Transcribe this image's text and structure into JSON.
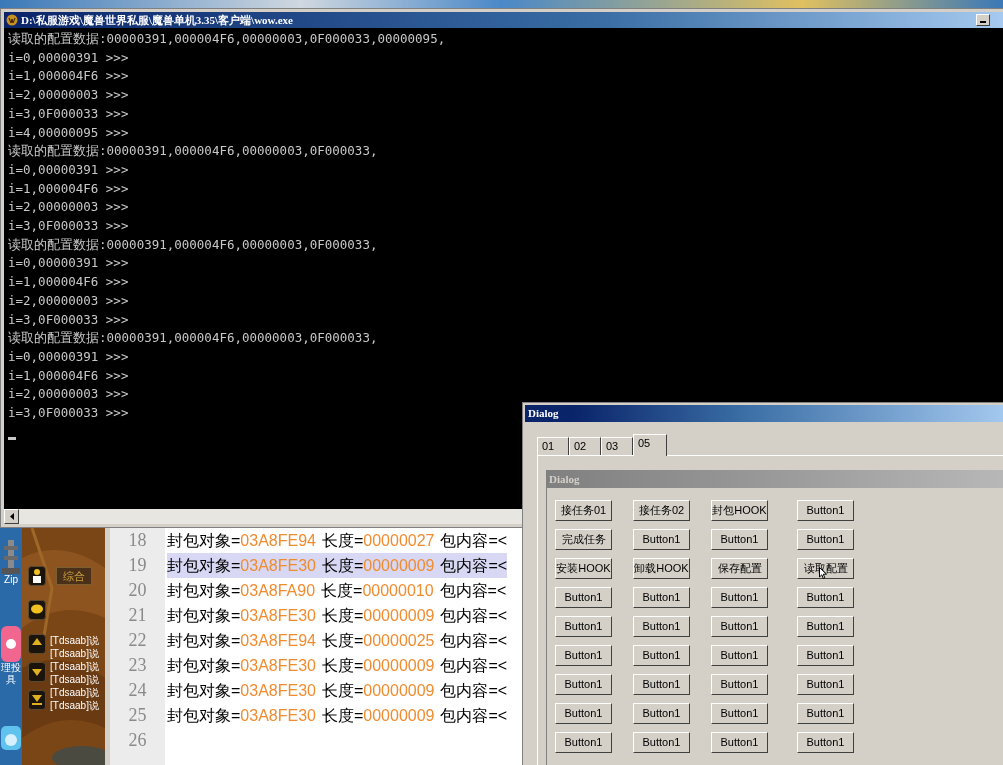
{
  "desktop_icons": [
    {
      "kind": "zip",
      "labels": [
        "Zip"
      ]
    },
    {
      "kind": "app",
      "labels": [
        "理投",
        "具"
      ]
    },
    {
      "kind": "face"
    }
  ],
  "game_chat": {
    "tab": "综合",
    "messages": [
      "[Tdsaab]说",
      "[Tdsaab]说",
      "[Tdsaab]说",
      "[Tdsaab]说",
      "[Tdsaab]说",
      "[Tdsaab]说"
    ]
  },
  "editor": {
    "lines": [
      {
        "number": "18",
        "object_label": "封包对象=",
        "object": "03A8FE94",
        "length_label": "长度=",
        "length": "00000027",
        "content_label": "包内容=<",
        "selected": false
      },
      {
        "number": "19",
        "object_label": "封包对象=",
        "object": "03A8FE30",
        "length_label": "长度=",
        "length": "00000009",
        "content_label": "包内容=<",
        "selected": true
      },
      {
        "number": "20",
        "object_label": "封包对象=",
        "object": "03A8FA90",
        "length_label": "长度=",
        "length": "00000010",
        "content_label": "包内容=<",
        "selected": false
      },
      {
        "number": "21",
        "object_label": "封包对象=",
        "object": "03A8FE30",
        "length_label": "长度=",
        "length": "00000009",
        "content_label": "包内容=<",
        "selected": false
      },
      {
        "number": "22",
        "object_label": "封包对象=",
        "object": "03A8FE94",
        "length_label": "长度=",
        "length": "00000025",
        "content_label": "包内容=<",
        "selected": false
      },
      {
        "number": "23",
        "object_label": "封包对象=",
        "object": "03A8FE30",
        "length_label": "长度=",
        "length": "00000009",
        "content_label": "包内容=<",
        "selected": false
      },
      {
        "number": "24",
        "object_label": "封包对象=",
        "object": "03A8FE30",
        "length_label": "长度=",
        "length": "00000009",
        "content_label": "包内容=<",
        "selected": false
      },
      {
        "number": "25",
        "object_label": "封包对象=",
        "object": "03A8FE30",
        "length_label": "长度=",
        "length": "00000009",
        "content_label": "包内容=<",
        "selected": false
      },
      {
        "number": "26"
      }
    ]
  },
  "console_window": {
    "title": "D:\\私服游戏\\魔兽世界私服\\魔兽单机3.35\\客户端\\wow.exe",
    "lines": [
      "读取的配置数据:00000391,000004F6,00000003,0F000033,00000095,",
      "i=0,00000391 >>>",
      "i=1,000004F6 >>>",
      "i=2,00000003 >>>",
      "i=3,0F000033 >>>",
      "i=4,00000095 >>>",
      "读取的配置数据:00000391,000004F6,00000003,0F000033,",
      "i=0,00000391 >>>",
      "i=1,000004F6 >>>",
      "i=2,00000003 >>>",
      "i=3,0F000033 >>>",
      "读取的配置数据:00000391,000004F6,00000003,0F000033,",
      "i=0,00000391 >>>",
      "i=1,000004F6 >>>",
      "i=2,00000003 >>>",
      "i=3,0F000033 >>>",
      "读取的配置数据:00000391,000004F6,00000003,0F000033,",
      "i=0,00000391 >>>",
      "i=1,000004F6 >>>",
      "i=2,00000003 >>>",
      "i=3,0F000033 >>>"
    ]
  },
  "dialog": {
    "title": "Dialog",
    "tabs": [
      {
        "label": "01",
        "selected": false
      },
      {
        "label": "02",
        "selected": false
      },
      {
        "label": "03",
        "selected": false
      },
      {
        "label": "05",
        "selected": true
      }
    ],
    "inner_title": "Dialog",
    "button_rows": [
      [
        "接任务01",
        "接任务02",
        "封包HOOK",
        "Button1"
      ],
      [
        "完成任务",
        "Button1",
        "Button1",
        "Button1"
      ],
      [
        "安装HOOK",
        "卸载HOOK",
        "保存配置",
        "读取配置"
      ],
      [
        "Button1",
        "Button1",
        "Button1",
        "Button1"
      ],
      [
        "Button1",
        "Button1",
        "Button1",
        "Button1"
      ],
      [
        "Button1",
        "Button1",
        "Button1",
        "Button1"
      ],
      [
        "Button1",
        "Button1",
        "Button1",
        "Button1"
      ],
      [
        "Button1",
        "Button1",
        "Button1",
        "Button1"
      ],
      [
        "Button1",
        "Button1",
        "Button1",
        "Button1"
      ]
    ]
  }
}
